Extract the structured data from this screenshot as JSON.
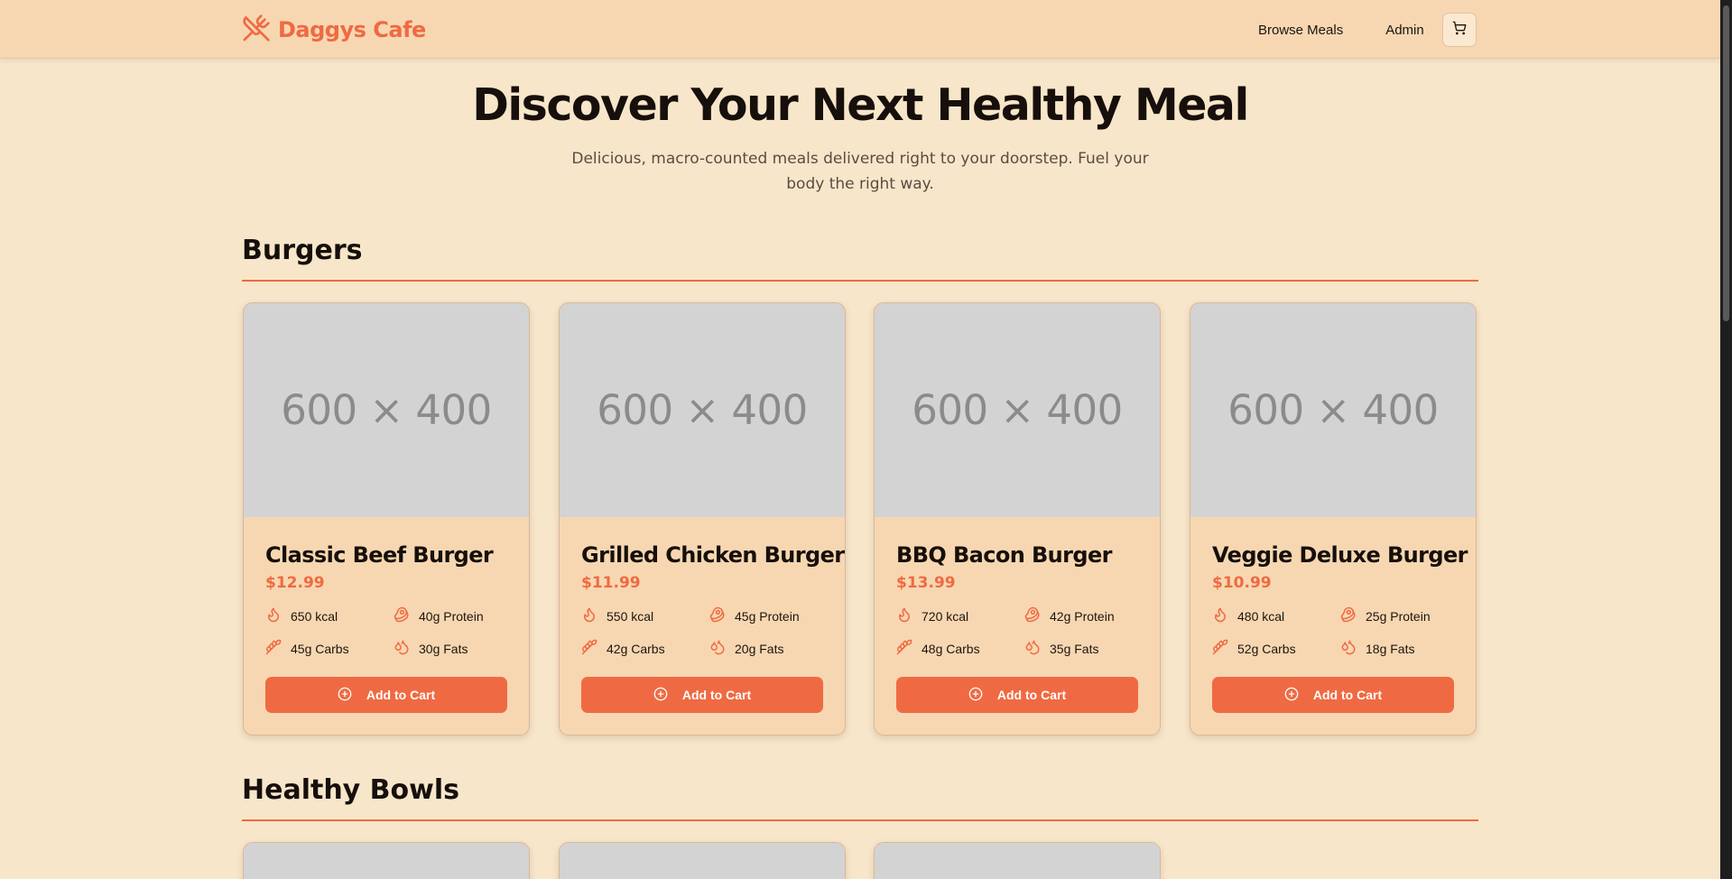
{
  "header": {
    "brand": "Daggys Cafe",
    "nav": {
      "browse": "Browse Meals",
      "admin": "Admin"
    }
  },
  "hero": {
    "title": "Discover Your Next Healthy Meal",
    "subtitle": "Delicious, macro-counted meals delivered right to your doorstep. Fuel your body the right way."
  },
  "sections": [
    {
      "title": "Burgers",
      "items": [
        {
          "image_placeholder": "600 × 400",
          "name": "Classic Beef Burger",
          "price": "$12.99",
          "kcal": "650 kcal",
          "protein": "40g Protein",
          "carbs": "45g Carbs",
          "fats": "30g Fats",
          "button": "Add to Cart"
        },
        {
          "image_placeholder": "600 × 400",
          "name": "Grilled Chicken Burger",
          "price": "$11.99",
          "kcal": "550 kcal",
          "protein": "45g Protein",
          "carbs": "42g Carbs",
          "fats": "20g Fats",
          "button": "Add to Cart"
        },
        {
          "image_placeholder": "600 × 400",
          "name": "BBQ Bacon Burger",
          "price": "$13.99",
          "kcal": "720 kcal",
          "protein": "42g Protein",
          "carbs": "48g Carbs",
          "fats": "35g Fats",
          "button": "Add to Cart"
        },
        {
          "image_placeholder": "600 × 400",
          "name": "Veggie Deluxe Burger",
          "price": "$10.99",
          "kcal": "480 kcal",
          "protein": "25g Protein",
          "carbs": "52g Carbs",
          "fats": "18g Fats",
          "button": "Add to Cart"
        }
      ]
    },
    {
      "title": "Healthy Bowls"
    }
  ],
  "icons": {
    "brand": "utensils-crossed-icon",
    "cart": "shopping-cart-icon",
    "kcal": "flame-icon",
    "protein": "beef-icon",
    "carbs": "wheat-icon",
    "fats": "droplets-icon",
    "add": "plus-circle-icon"
  },
  "colors": {
    "page_bg": "#f8e6ca",
    "header_bg": "#f7d7b1",
    "accent": "#ef6a42",
    "image_placeholder_bg": "#d4d3d3"
  }
}
